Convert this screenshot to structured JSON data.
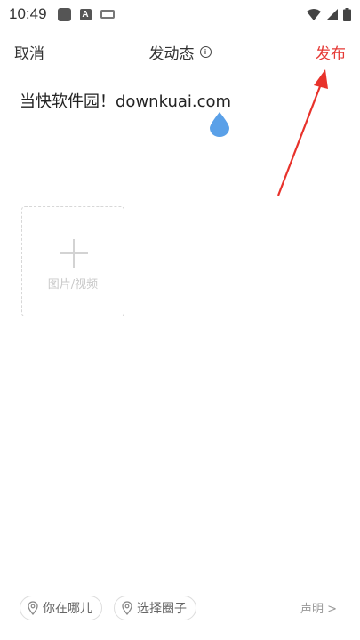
{
  "status_bar": {
    "time": "10:49",
    "icons": [
      "square-icon",
      "a-badge-icon",
      "keyboard-icon",
      "wifi-icon",
      "signal-icon",
      "battery-icon"
    ]
  },
  "header": {
    "cancel_label": "取消",
    "title": "发动态",
    "publish_label": "发布",
    "publish_color": "#e53935"
  },
  "editor": {
    "text": "当快软件园！downkuai.com"
  },
  "media_picker": {
    "label": "图片/视频"
  },
  "bottom": {
    "location_label": "你在哪儿",
    "circle_label": "选择圈子",
    "statement_label": "声明 >"
  }
}
